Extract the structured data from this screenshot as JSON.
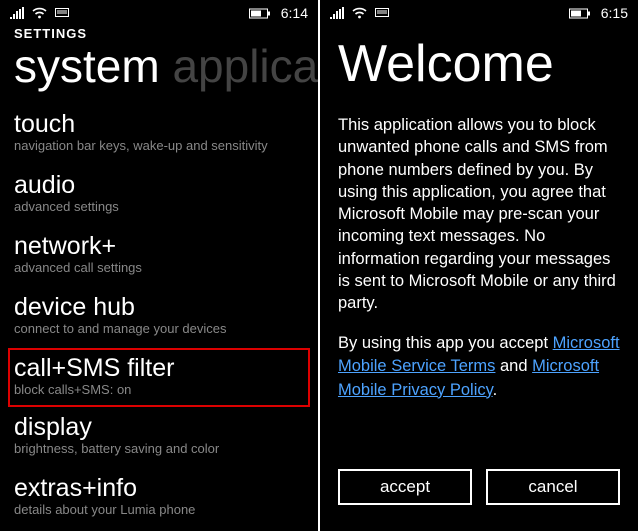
{
  "left": {
    "status": {
      "time": "6:14"
    },
    "header_small": "SETTINGS",
    "pivot_active": "system",
    "pivot_inactive": " applicati",
    "items": [
      {
        "title": "touch",
        "sub": "navigation bar keys, wake-up and sensitivity"
      },
      {
        "title": "audio",
        "sub": "advanced settings"
      },
      {
        "title": "network+",
        "sub": "advanced call settings"
      },
      {
        "title": "device hub",
        "sub": "connect to and manage your devices"
      },
      {
        "title": "call+SMS filter",
        "sub": "block calls+SMS: on"
      },
      {
        "title": "display",
        "sub": "brightness, battery saving and color"
      },
      {
        "title": "extras+info",
        "sub": "details about your Lumia phone"
      }
    ]
  },
  "right": {
    "status": {
      "time": "6:15"
    },
    "title": "Welcome",
    "body": "This application allows you to block unwanted phone calls and SMS from phone numbers defined by you. By using this application, you agree that Microsoft Mobile may pre-scan your incoming text messages. No information regarding your messages is sent to Microsoft Mobile or any third party.",
    "accept_prefix": "By using this app you accept ",
    "link1": "Microsoft Mobile Service Terms",
    "and": " and ",
    "link2": "Microsoft Mobile Privacy Policy",
    "period": ".",
    "accept_btn": "accept",
    "cancel_btn": "cancel"
  }
}
